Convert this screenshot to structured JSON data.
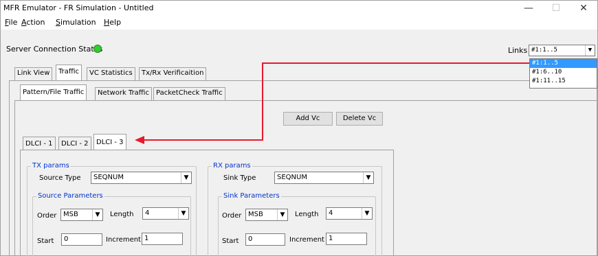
{
  "window": {
    "title": "MFR Emulator - FR Simulation - Untitled"
  },
  "menu": {
    "items": [
      {
        "u": "F",
        "rest": "ile"
      },
      {
        "u": "A",
        "rest": "ction"
      },
      {
        "u": "S",
        "rest": "imulation"
      },
      {
        "u": "H",
        "rest": "elp"
      }
    ]
  },
  "status": {
    "label": "Server Connection Status",
    "led_color": "#2fcf2f"
  },
  "links": {
    "label": "Links",
    "selected": "#1:1..5",
    "options": [
      "#1:1..5",
      "#1:6..10",
      "#1:11..15"
    ]
  },
  "main_tabs": [
    "Link View",
    "Traffic",
    "VC Statistics",
    "Tx/Rx Verificaition"
  ],
  "sub_tabs": [
    "Pattern/File Traffic",
    "Network Traffic",
    "PacketCheck Traffic"
  ],
  "buttons": {
    "add_vc": "Add Vc",
    "delete_vc": "Delete Vc"
  },
  "dlci_tabs": [
    "DLCI - 1",
    "DLCI - 2",
    "DLCI - 3"
  ],
  "tx": {
    "legend": "TX params",
    "type_label": "Source Type",
    "type_value": "SEQNUM",
    "params_legend": "Source Parameters",
    "order_label": "Order",
    "order_value": "MSB",
    "length_label": "Length",
    "length_value": "4",
    "start_label": "Start",
    "start_value": "0",
    "increment_label": "Increment",
    "increment_value": "1"
  },
  "rx": {
    "legend": "RX params",
    "type_label": "Sink Type",
    "type_value": "SEQNUM",
    "params_legend": "Sink Parameters",
    "order_label": "Order",
    "order_value": "MSB",
    "length_label": "Length",
    "length_value": "4",
    "start_label": "Start",
    "start_value": "0",
    "increment_label": "Increment",
    "increment_value": "1"
  },
  "annotation": {
    "color": "#e8192c"
  }
}
